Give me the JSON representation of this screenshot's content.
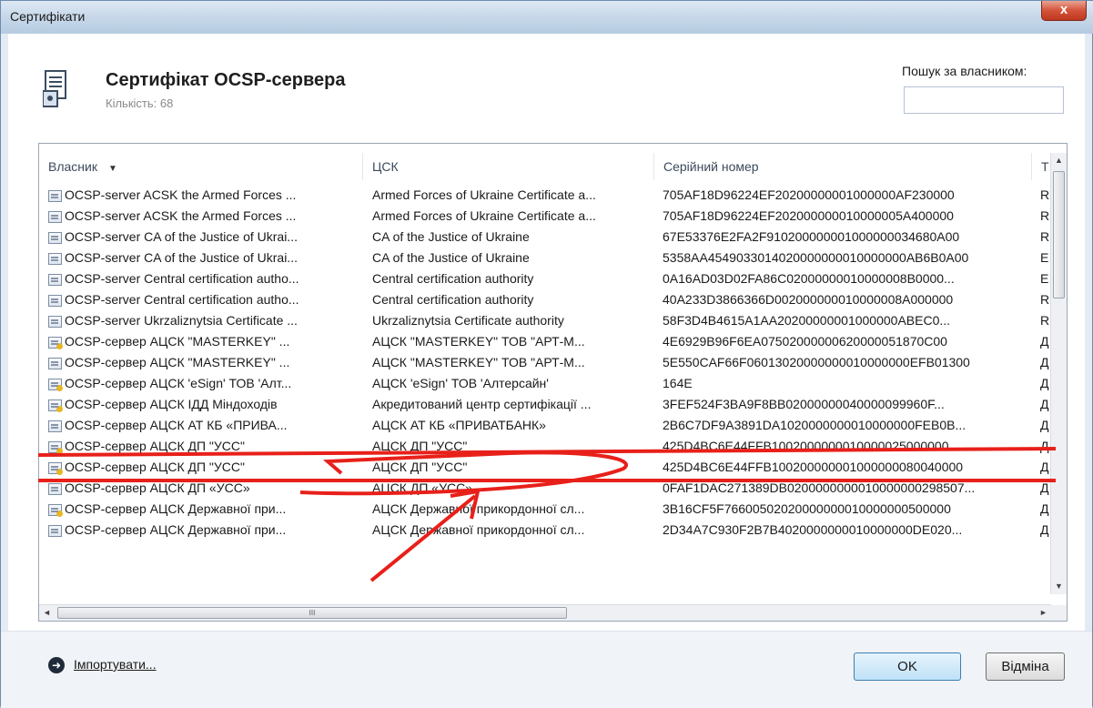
{
  "window": {
    "title": "Сертифікати",
    "close_label": "x"
  },
  "header": {
    "title": "Сертифікат OCSP-сервера",
    "count": "Кількість: 68"
  },
  "search": {
    "label": "Пошук за власником:",
    "value": ""
  },
  "columns": {
    "owner": "Власник",
    "ca": "ЦСК",
    "serial": "Серійний номер",
    "type": "Т"
  },
  "rows": [
    {
      "icon": "certificate-icon",
      "owner": "OCSP-server ACSK the Armed Forces ...",
      "ca": "Armed Forces of Ukraine Certificate a...",
      "serial": "705AF18D96224EF20200000001000000AF230000",
      "type": "R"
    },
    {
      "icon": "certificate-icon",
      "owner": "OCSP-server ACSK the Armed Forces ...",
      "ca": "Armed Forces of Ukraine Certificate a...",
      "serial": "705AF18D96224EF202000000010000005A400000",
      "type": "R"
    },
    {
      "icon": "certificate-icon",
      "owner": "OCSP-server CA of the Justice of Ukrai...",
      "ca": "CA of the Justice of Ukraine",
      "serial": "67E53376E2FA2F910200000001000000034680A00",
      "type": "R"
    },
    {
      "icon": "certificate-icon",
      "owner": "OCSP-server CA of the Justice of Ukrai...",
      "ca": "CA of the Justice of Ukraine",
      "serial": "5358AA4549033014020000000010000000AB6B0A00",
      "type": "E"
    },
    {
      "icon": "certificate-icon",
      "owner": "OCSP-server Central certification autho...",
      "ca": "Central certification authority",
      "serial": "0A16AD03D02FA86C02000000010000008B0000...",
      "type": "E"
    },
    {
      "icon": "certificate-icon",
      "owner": "OCSP-server Central certification autho...",
      "ca": "Central certification authority",
      "serial": "40A233D3866366D002000000010000008A000000",
      "type": "R"
    },
    {
      "icon": "certificate-icon",
      "owner": "OCSP-server Ukrzaliznytsia Certificate ...",
      "ca": "Ukrzaliznytsia Certificate authority",
      "serial": "58F3D4B4615A1AA20200000001000000ABEC0...",
      "type": "R"
    },
    {
      "icon": "certificate-key-icon",
      "owner": "OCSP-сервер АЦСК \"MASTERKEY\" ...",
      "ca": "АЦСК \"MASTERKEY\" ТОВ \"АРТ-М...",
      "serial": "4E6929B96F6EA07502000000620000051870C00",
      "type": "Д"
    },
    {
      "icon": "certificate-icon",
      "owner": "OCSP-сервер АЦСК \"MASTERKEY\" ...",
      "ca": "АЦСК \"MASTERKEY\" ТОВ \"АРТ-М...",
      "serial": "5E550CAF66F06013020000000010000000EFB01300",
      "type": "Д"
    },
    {
      "icon": "certificate-key-icon",
      "owner": "OCSP-сервер АЦСК 'eSign' ТОВ 'Алт...",
      "ca": "АЦСК 'eSign' ТОВ 'Алтерсайн'",
      "serial": "164E",
      "type": "Д"
    },
    {
      "icon": "certificate-key-icon",
      "owner": "OCSP-сервер АЦСК ІДД Міндоходів",
      "ca": "Акредитований центр сертифікації ...",
      "serial": "3FEF524F3BA9F8BB02000000040000099960F...",
      "type": "Д"
    },
    {
      "icon": "certificate-icon",
      "owner": "OCSP-сервер АЦСК АТ КБ «ПРИВА...",
      "ca": "АЦСК АТ КБ «ПРИВАТБАНК»",
      "serial": "2B6C7DF9A3891DA1020000000010000000FEB0B...",
      "type": "Д"
    },
    {
      "icon": "certificate-key-icon",
      "owner": "OCSP-сервер АЦСК ДП \"УСС\"",
      "ca": "АЦСК ДП \"УСС\"",
      "serial": "425D4BC6E44FFB1002000000010000025000000",
      "type": "Д"
    },
    {
      "icon": "certificate-key-icon",
      "owner": "OCSP-сервер АЦСК ДП \"УСС\"",
      "ca": "АЦСК ДП \"УСС\"",
      "serial": "425D4BC6E44FFB100200000001000000080040000",
      "type": "Д"
    },
    {
      "icon": "certificate-icon",
      "owner": "OCSP-сервер АЦСК ДП «УСС»",
      "ca": "АЦСК ДП «УСС»",
      "serial": "0FAF1DAC271389DB0200000000010000000298507...",
      "type": "Д"
    },
    {
      "icon": "certificate-key-icon",
      "owner": "OCSP-сервер АЦСК Державної при...",
      "ca": "АЦСК Державної прикордонної сл...",
      "serial": "3B16CF5F76600502020000000010000000500000",
      "type": "Д"
    },
    {
      "icon": "certificate-icon",
      "owner": "OCSP-сервер АЦСК Державної при...",
      "ca": "АЦСК Державної прикордонної сл...",
      "serial": "2D34A7C930F2B7B4020000000010000000DE020...",
      "type": "Д"
    }
  ],
  "hscroll_label": "III",
  "footer": {
    "import_label": "Імпортувати...",
    "ok_label": "OK",
    "cancel_label": "Відміна"
  },
  "annotation_color": "#e8201a"
}
